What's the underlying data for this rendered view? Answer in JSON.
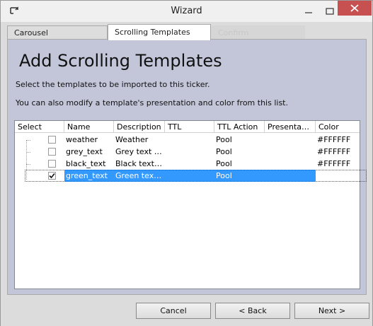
{
  "window": {
    "title": "Wizard"
  },
  "tabs": [
    {
      "label": "Carousel"
    },
    {
      "label": "Scrolling Templates"
    },
    {
      "label": "Confirm"
    }
  ],
  "page": {
    "heading": "Add Scrolling Templates",
    "instruction_1": "Select the templates to be imported to this ticker.",
    "instruction_2": "You can also modify a template's presentation and color from this list."
  },
  "grid": {
    "columns": [
      "Select",
      "Name",
      "Description",
      "TTL",
      "TTL Action",
      "Presenta…",
      "Color"
    ],
    "rows": [
      {
        "selected_check": false,
        "name": "weather",
        "description": "Weather",
        "ttl": "",
        "ttl_action": "Pool",
        "presentation": "",
        "color": "#FFFFFF"
      },
      {
        "selected_check": false,
        "name": "grey_text",
        "description": "Grey text …",
        "ttl": "",
        "ttl_action": "Pool",
        "presentation": "",
        "color": "#FFFFFF"
      },
      {
        "selected_check": false,
        "name": "black_text",
        "description": "Black text…",
        "ttl": "",
        "ttl_action": "Pool",
        "presentation": "",
        "color": "#FFFFFF"
      },
      {
        "selected_check": true,
        "name": "green_text",
        "description": "Green tex…",
        "ttl": "",
        "ttl_action": "Pool",
        "presentation": "",
        "color": ""
      }
    ],
    "selected_row_index": 3
  },
  "footer": {
    "cancel_label": "Cancel",
    "back_label": "< Back",
    "next_label": "Next >"
  },
  "colors": {
    "panel_background": "#c3c6d9",
    "selection": "#3399ff",
    "close_button": "#c75050"
  }
}
